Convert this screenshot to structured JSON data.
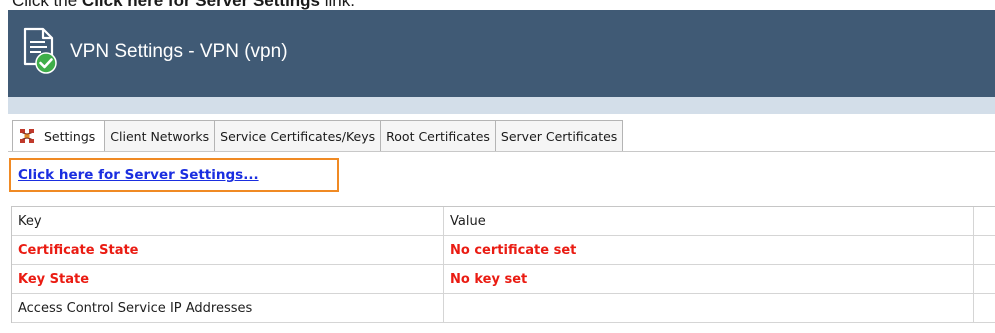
{
  "instruction": {
    "prefix": "Click the ",
    "emphasis": "Click here for Server Settings",
    "suffix": " link."
  },
  "window": {
    "title": "VPN Settings - VPN (vpn)",
    "icon": "document-checkmark-icon",
    "titlebar_color": "#405a75"
  },
  "tabs": [
    {
      "label": "Settings",
      "icon": "network-settings-icon",
      "active": true
    },
    {
      "label": "Client Networks"
    },
    {
      "label": "Service Certificates/Keys"
    },
    {
      "label": "Root Certificates"
    },
    {
      "label": "Server Certificates"
    }
  ],
  "server_link": {
    "label": "Click here for Server Settings...",
    "highlight_color": "#f08a24"
  },
  "table": {
    "columns": [
      "Key",
      "Value"
    ],
    "rows": [
      {
        "key": "Certificate State",
        "value": "No certificate set",
        "alert": true
      },
      {
        "key": "Key State",
        "value": "No key set",
        "alert": true
      },
      {
        "key": "Access Control Service IP Addresses",
        "value": ""
      }
    ],
    "alert_color": "#ea1b12"
  }
}
